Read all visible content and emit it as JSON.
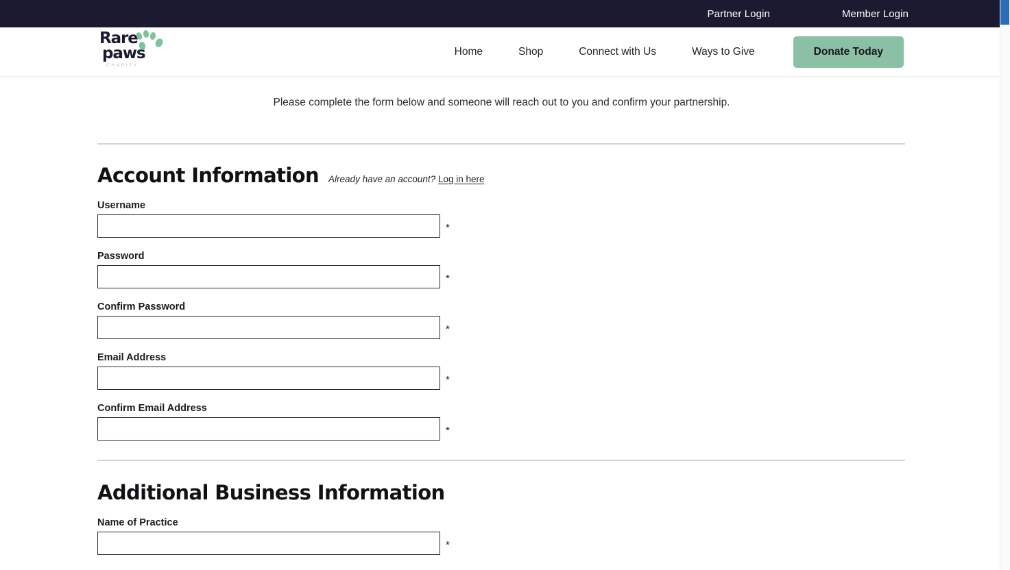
{
  "topbar": {
    "links": [
      {
        "label": "Partner Login"
      },
      {
        "label": "Member Login"
      }
    ]
  },
  "header": {
    "logo": {
      "line1": "Rare",
      "line2": "paws",
      "tagline": "CHARITY",
      "brand_color": "#1c1a30",
      "paw_color": "#7cc49a"
    },
    "nav": [
      {
        "label": "Home"
      },
      {
        "label": "Shop"
      },
      {
        "label": "Connect with Us"
      },
      {
        "label": "Ways to Give"
      }
    ],
    "donate_label": "Donate Today",
    "donate_color": "#8cc0a4"
  },
  "main": {
    "intro": "Please complete the form below and someone will reach out to you and confirm your partnership.",
    "sections": [
      {
        "title": "Account Information",
        "note_italic": "Already have an account?",
        "note_link": "Log in here",
        "fields": [
          {
            "label": "Username",
            "value": "",
            "placeholder": "",
            "required_mark": "*",
            "type": "text"
          },
          {
            "label": "Password",
            "value": "",
            "placeholder": "",
            "required_mark": "*",
            "type": "password"
          },
          {
            "label": "Confirm Password",
            "value": "",
            "placeholder": "",
            "required_mark": "*",
            "type": "password"
          },
          {
            "label": "Email Address",
            "value": "",
            "placeholder": "",
            "required_mark": "*",
            "type": "text"
          },
          {
            "label": "Confirm Email Address",
            "value": "",
            "placeholder": "",
            "required_mark": "*",
            "type": "text"
          }
        ]
      },
      {
        "title": "Additional Business Information",
        "fields": [
          {
            "label": "Name of Practice",
            "value": "",
            "placeholder": "",
            "required_mark": "*",
            "type": "text"
          }
        ]
      }
    ]
  }
}
